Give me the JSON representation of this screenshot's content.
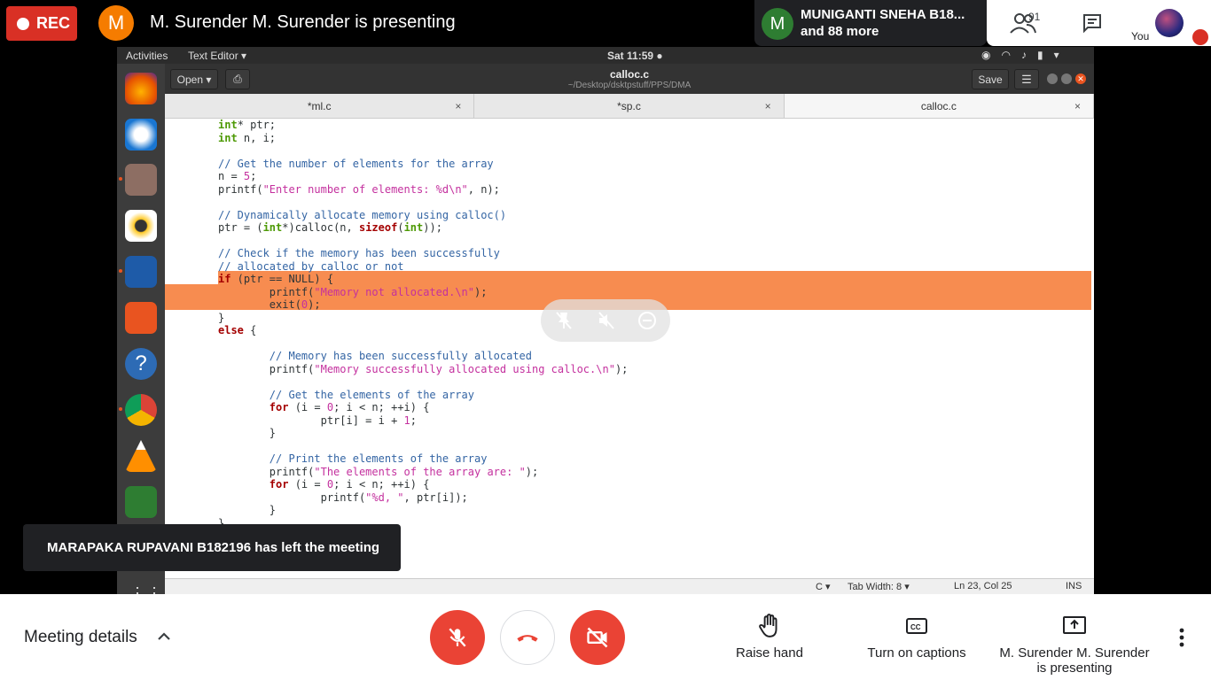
{
  "meet": {
    "rec_label": "REC",
    "presenter_initial": "M",
    "presenting_title": "M. Surender M. Surender is presenting",
    "tile_initial": "M",
    "tile_name": "MUNIGANTI SNEHA B18...",
    "tile_more": "and 88 more",
    "people_count": "91",
    "you_label": "You",
    "toast": "MARAPAKA RUPAVANI B182196 has left the meeting",
    "meeting_details": "Meeting details",
    "raise_hand": "Raise hand",
    "captions": "Turn on captions",
    "present_line1": "M. Surender M. Surender",
    "present_line2": "is presenting",
    "accent": "#ea4335"
  },
  "ubuntu": {
    "activities": "Activities",
    "app_name": "Text Editor ▾",
    "clock": "Sat 11:59 ●",
    "open_label": "Open ▾",
    "doc_title": "calloc.c",
    "doc_path": "~/Desktop/dsktpstuff/PPS/DMA",
    "save_label": "Save",
    "tabs": [
      {
        "label": "*ml.c",
        "close": "×"
      },
      {
        "label": "*sp.c",
        "close": "×"
      },
      {
        "label": "calloc.c",
        "close": "×"
      }
    ],
    "status": {
      "lang": "C ▾",
      "tab_width": "Tab Width: 8 ▾",
      "position": "Ln 23, Col 25",
      "mode": "INS"
    }
  }
}
